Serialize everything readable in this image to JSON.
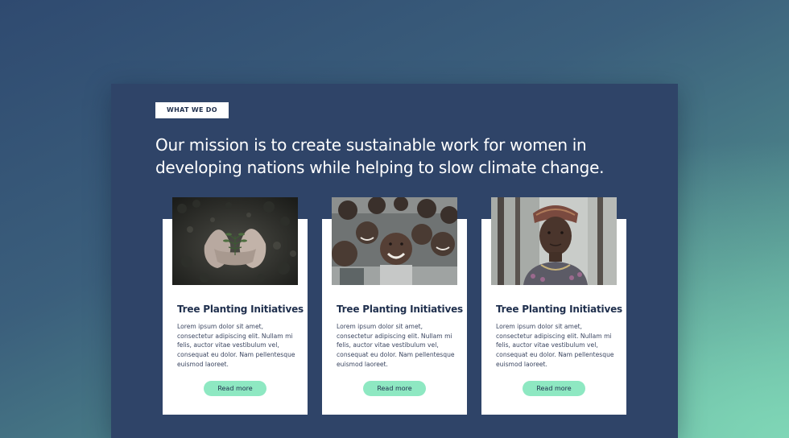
{
  "section": {
    "eyebrow": "WHAT WE DO",
    "headline_line1": "Our mission is to create sustainable work for women in",
    "headline_line2": "developing nations while helping to slow climate change."
  },
  "cards": [
    {
      "image": "hands-holding-seedling-photo",
      "title": "Tree Planting Initiatives",
      "body": "Lorem ipsum dolor sit amet, consectetur adipiscing elit. Nullam mi felis, auctor vitae vestibulum vel, consequat eu dolor. Nam pellentesque euismod laoreet.",
      "button": "Read more"
    },
    {
      "image": "smiling-children-group-photo",
      "title": "Tree Planting Initiatives",
      "body": "Lorem ipsum dolor sit amet, consectetur adipiscing elit. Nullam mi felis, auctor vitae vestibulum vel, consequat eu dolor. Nam pellentesque euismod laoreet.",
      "button": "Read more"
    },
    {
      "image": "woman-with-headwrap-portrait-photo",
      "title": "Tree Planting Initiatives",
      "body": "Lorem ipsum dolor sit amet, consectetur adipiscing elit. Nullam mi felis, auctor vitae vestibulum vel, consequat eu dolor. Nam pellentesque euismod laoreet.",
      "button": "Read more"
    }
  ],
  "colors": {
    "panel": "#2f4468",
    "accent_button": "#8ee8c2",
    "heading_text": "#1f2f4d"
  }
}
